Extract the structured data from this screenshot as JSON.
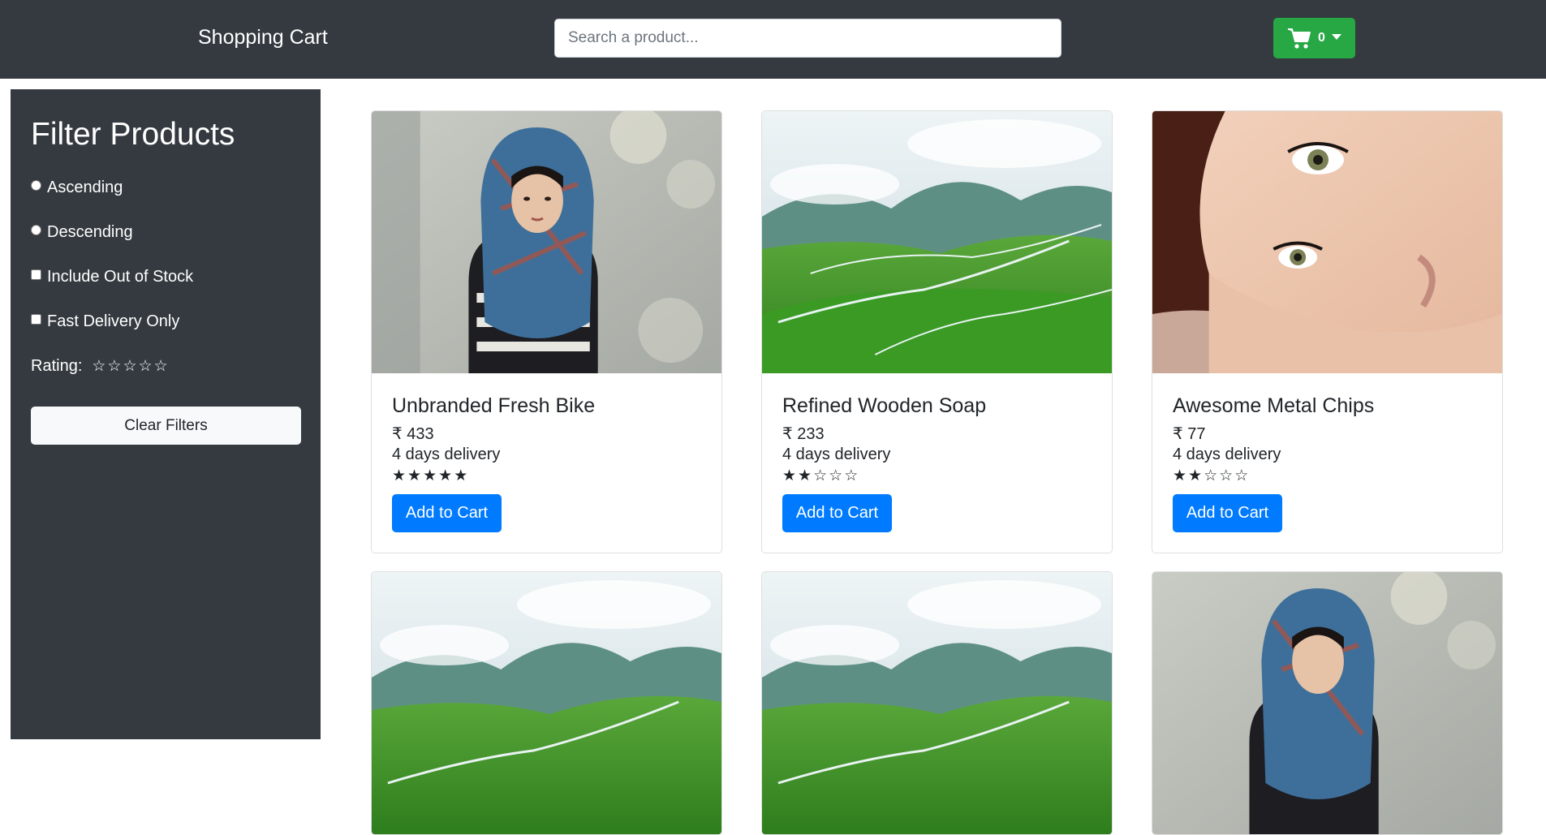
{
  "navbar": {
    "brand": "Shopping Cart",
    "search_placeholder": "Search a product...",
    "cart_count": "0",
    "cart_icon": "cart-icon",
    "dropdown_icon": "caret-down-icon"
  },
  "sidebar": {
    "title": "Filter Products",
    "options": [
      {
        "label": "Ascending",
        "type": "radio",
        "checked": false
      },
      {
        "label": "Descending",
        "type": "radio",
        "checked": false
      },
      {
        "label": "Include Out of Stock",
        "type": "checkbox",
        "checked": false
      },
      {
        "label": "Fast Delivery Only",
        "type": "checkbox",
        "checked": false
      }
    ],
    "rating_label": "Rating:",
    "rating_value": 0,
    "rating_max": 5,
    "clear_label": "Clear Filters"
  },
  "products": [
    {
      "name": "Unbranded Fresh Bike",
      "price": "₹ 433",
      "delivery": "4 days delivery",
      "rating": 5,
      "image": "woman-in-scarf",
      "button": "Add to Cart"
    },
    {
      "name": "Refined Wooden Soap",
      "price": "₹ 233",
      "delivery": "4 days delivery",
      "rating": 2,
      "image": "green-valley",
      "button": "Add to Cart"
    },
    {
      "name": "Awesome Metal Chips",
      "price": "₹ 77",
      "delivery": "4 days delivery",
      "rating": 2,
      "image": "woman-portrait",
      "button": "Add to Cart"
    },
    {
      "image": "green-valley"
    },
    {
      "image": "green-valley"
    },
    {
      "image": "woman-in-scarf"
    }
  ],
  "colors": {
    "navbar": "#343a40",
    "cart_button": "#28a745",
    "add_button": "#007bff",
    "clear_button": "#f8f9fa"
  }
}
